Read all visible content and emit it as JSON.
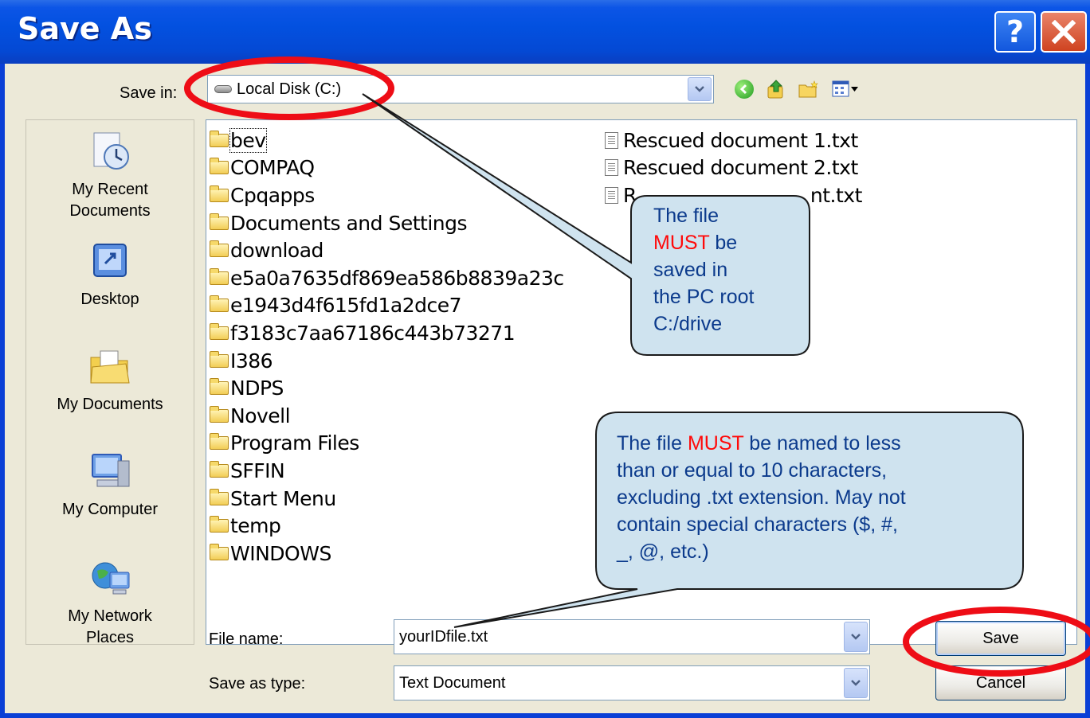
{
  "window": {
    "title": "Save As",
    "help_icon": "question-mark-icon",
    "close_icon": "close-icon"
  },
  "toolbar": {
    "save_in_label": "Save in:",
    "save_in_value": "Local Disk (C:)",
    "icons": [
      "back-icon",
      "up-folder-icon",
      "new-folder-icon",
      "views-menu-icon"
    ]
  },
  "places": [
    {
      "label": "My Recent Documents",
      "line1": "My Recent",
      "line2": "Documents",
      "icon": "recent-documents-icon"
    },
    {
      "label": "Desktop",
      "line1": "Desktop",
      "line2": "",
      "icon": "desktop-icon"
    },
    {
      "label": "My Documents",
      "line1": "My Documents",
      "line2": "",
      "icon": "my-documents-icon"
    },
    {
      "label": "My Computer",
      "line1": "My Computer",
      "line2": "",
      "icon": "my-computer-icon"
    },
    {
      "label": "My Network Places",
      "line1": "My Network",
      "line2": "Places",
      "icon": "network-places-icon"
    }
  ],
  "files": {
    "folders": [
      "bev",
      "COMPAQ",
      "Cpqapps",
      "Documents and Settings",
      "download",
      "e5a0a7635df869ea586b8839a23c",
      "e1943d4f615fd1a2dce7",
      "f3183c7aa67186c443b73271",
      "I386",
      "NDPS",
      "Novell",
      "Program Files",
      "SFFIN",
      "Start Menu",
      "temp",
      "WINDOWS"
    ],
    "text_files": [
      "Rescued document 1.txt",
      "Rescued document 2.txt",
      "Rescued document.txt"
    ],
    "third_visible_fragments": {
      "start": "R",
      "end": "nt.txt"
    }
  },
  "fields": {
    "file_name_label": "File name:",
    "file_name_value": "yourIDfile.txt",
    "save_as_type_label": "Save as type:",
    "save_as_type_value": "Text Document"
  },
  "buttons": {
    "save": "Save",
    "cancel": "Cancel"
  },
  "annotations": {
    "callout_1": {
      "line1": "The file",
      "must": "MUST",
      "line2_rest": " be",
      "line3": "saved in",
      "line4": "the PC root",
      "line5": "C:/drive"
    },
    "callout_2": {
      "prefix": "The file ",
      "must": "MUST",
      "line1_rest": " be named to less",
      "line2": "than or equal to 10 characters,",
      "line3": "excluding .txt extension.  May not",
      "line4": "contain special characters ($, #,",
      "line5": "_, @, etc.)"
    },
    "highlight_color": "#ee0d16",
    "callout_fill": "#cfe3ef",
    "callout_text_color": "#0b3a8c"
  }
}
